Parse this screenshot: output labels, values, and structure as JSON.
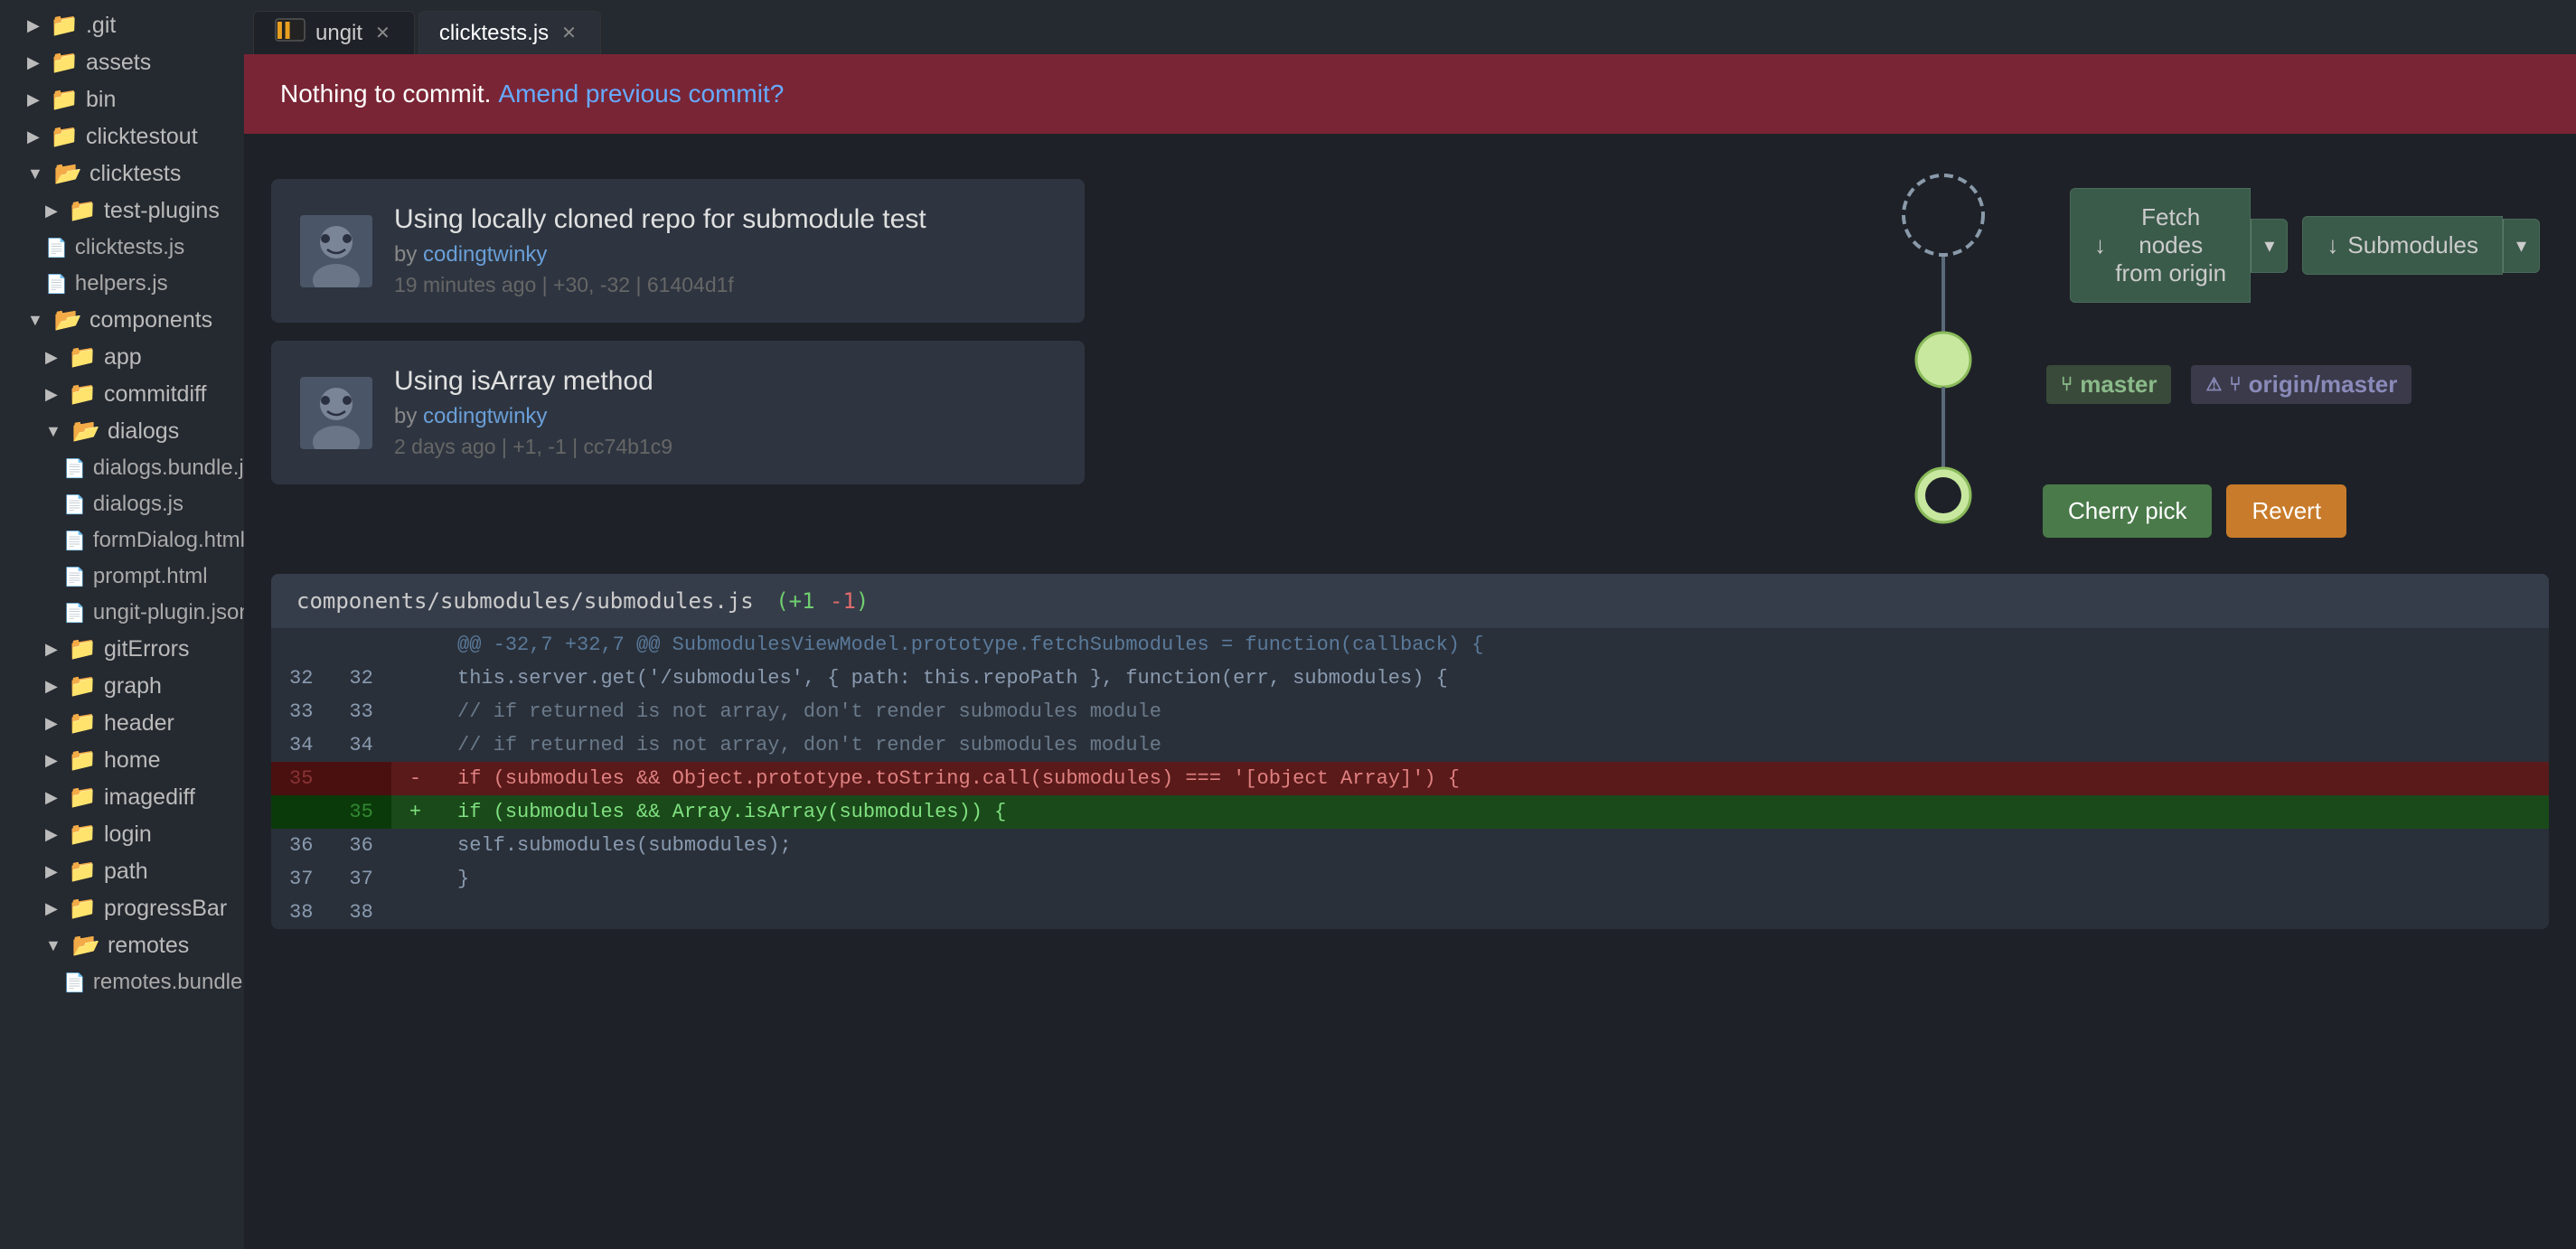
{
  "sidebar": {
    "items": [
      {
        "label": ".git",
        "type": "folder",
        "indent": 0,
        "collapsed": true
      },
      {
        "label": "assets",
        "type": "folder",
        "indent": 0,
        "collapsed": true
      },
      {
        "label": "bin",
        "type": "folder",
        "indent": 0,
        "collapsed": true
      },
      {
        "label": "clicktestout",
        "type": "folder",
        "indent": 0,
        "collapsed": true
      },
      {
        "label": "clicktests",
        "type": "folder",
        "indent": 0,
        "collapsed": false
      },
      {
        "label": "test-plugins",
        "type": "folder",
        "indent": 1,
        "collapsed": true
      },
      {
        "label": "clicktests.js",
        "type": "file",
        "indent": 1
      },
      {
        "label": "helpers.js",
        "type": "file",
        "indent": 1
      },
      {
        "label": "components",
        "type": "folder",
        "indent": 0,
        "collapsed": false
      },
      {
        "label": "app",
        "type": "folder",
        "indent": 1,
        "collapsed": true
      },
      {
        "label": "commitdiff",
        "type": "folder",
        "indent": 1,
        "collapsed": true
      },
      {
        "label": "dialogs",
        "type": "folder",
        "indent": 1,
        "collapsed": false
      },
      {
        "label": "dialogs.bundle.js",
        "type": "file",
        "indent": 2
      },
      {
        "label": "dialogs.js",
        "type": "file",
        "indent": 2
      },
      {
        "label": "formDialog.html",
        "type": "file",
        "indent": 2
      },
      {
        "label": "prompt.html",
        "type": "file",
        "indent": 2
      },
      {
        "label": "ungit-plugin.json",
        "type": "file",
        "indent": 2
      },
      {
        "label": "gitErrors",
        "type": "folder",
        "indent": 1,
        "collapsed": true
      },
      {
        "label": "graph",
        "type": "folder",
        "indent": 1,
        "collapsed": true
      },
      {
        "label": "header",
        "type": "folder",
        "indent": 1,
        "collapsed": true
      },
      {
        "label": "home",
        "type": "folder",
        "indent": 1,
        "collapsed": true
      },
      {
        "label": "imagediff",
        "type": "folder",
        "indent": 1,
        "collapsed": true
      },
      {
        "label": "login",
        "type": "folder",
        "indent": 1,
        "collapsed": true
      },
      {
        "label": "path",
        "type": "folder",
        "indent": 1,
        "collapsed": true
      },
      {
        "label": "progressBar",
        "type": "folder",
        "indent": 1,
        "collapsed": true
      },
      {
        "label": "remotes",
        "type": "folder",
        "indent": 1,
        "collapsed": false
      },
      {
        "label": "remotes.bundle.js",
        "type": "file",
        "indent": 2
      }
    ]
  },
  "tabs": [
    {
      "label": "ungit",
      "active": false,
      "closeable": true,
      "logo": true
    },
    {
      "label": "clicktests.js",
      "active": true,
      "closeable": true
    }
  ],
  "nothing_to_commit": {
    "text": "Nothing to commit. ",
    "link_text": "Amend previous commit?"
  },
  "top_buttons": {
    "fetch_label": "Fetch nodes from origin",
    "fetch_icon": "↓",
    "submodules_label": "Submodules",
    "submodules_icon": "↓",
    "dropdown_arrow": "▾"
  },
  "commits": [
    {
      "title": "Using locally cloned repo for submodule test",
      "author": "codingtwinky",
      "time_ago": "19 minutes ago",
      "stats": "+30, -32",
      "hash": "61404d1f",
      "branches": [
        "master"
      ],
      "remote_branches": [
        "origin/master"
      ]
    },
    {
      "title": "Using isArray method",
      "author": "codingtwinky",
      "time_ago": "2 days ago",
      "stats": "+1, -1",
      "hash": "cc74b1c9",
      "branches": [],
      "remote_branches": [],
      "actions": [
        "Cherry pick",
        "Revert"
      ]
    }
  ],
  "diff": {
    "file": "components/submodules/submodules.js",
    "added": "+1",
    "removed": "-1",
    "info_line": "@@ -32,7 +32,7 @@ SubmodulesViewModel.prototype.fetchSubmodules = function(callback) {",
    "lines": [
      {
        "old": "32",
        "new": "32",
        "type": "context",
        "content": "        this.server.get('/submodules', { path: this.repoPath }, function(err, submodules) {"
      },
      {
        "old": "33",
        "new": "33",
        "type": "context",
        "content": "            // if returned is not array, don't render submodules module"
      },
      {
        "old": "34",
        "new": "34",
        "type": "context",
        "content": "            // if returned is not array, don't render submodules module"
      },
      {
        "old": "35",
        "new": "",
        "type": "removed",
        "content": "            if (submodules && Object.prototype.toString.call(submodules) === '[object Array]') {"
      },
      {
        "old": "",
        "new": "35",
        "type": "added",
        "content": "            if (submodules && Array.isArray(submodules)) {"
      },
      {
        "old": "36",
        "new": "36",
        "type": "context",
        "content": "                self.submodules(submodules);"
      },
      {
        "old": "37",
        "new": "37",
        "type": "context",
        "content": "            }"
      },
      {
        "old": "38",
        "new": "38",
        "type": "context",
        "content": ""
      }
    ]
  },
  "branch_labels": {
    "master": "master",
    "origin_master": "origin/master"
  },
  "action_buttons": {
    "cherry_pick": "Cherry pick",
    "revert": "Revert"
  },
  "colors": {
    "accent_blue": "#6a9fd8",
    "accent_green": "#6fce6f",
    "accent_orange": "#c87b2a",
    "bg_dark": "#1e2228",
    "bg_card": "#2e3540",
    "bg_sidebar": "#252930"
  }
}
